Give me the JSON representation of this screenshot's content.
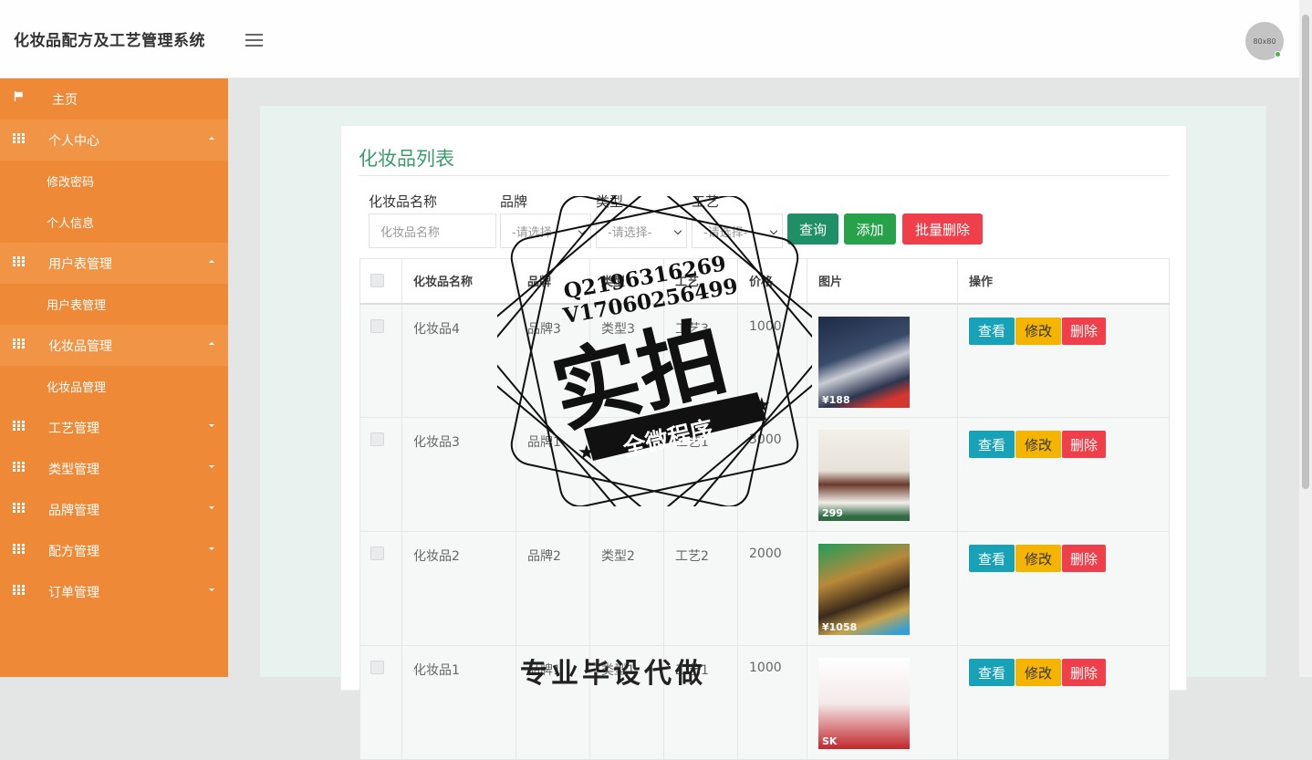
{
  "header": {
    "title": "化妆品配方及工艺管理系统",
    "avatar_text": "80x80"
  },
  "sidebar": {
    "home": "主页",
    "groups": [
      {
        "label": "个人中心",
        "open": true,
        "items": [
          "修改密码",
          "个人信息"
        ]
      },
      {
        "label": "用户表管理",
        "open": true,
        "items": [
          "用户表管理"
        ]
      },
      {
        "label": "化妆品管理",
        "open": true,
        "items": [
          "化妆品管理"
        ]
      },
      {
        "label": "工艺管理",
        "open": false,
        "items": []
      },
      {
        "label": "类型管理",
        "open": false,
        "items": []
      },
      {
        "label": "品牌管理",
        "open": false,
        "items": []
      },
      {
        "label": "配方管理",
        "open": false,
        "items": []
      },
      {
        "label": "订单管理",
        "open": false,
        "items": []
      }
    ]
  },
  "main": {
    "title": "化妆品列表",
    "filters": {
      "name_label": "化妆品名称",
      "name_placeholder": "化妆品名称",
      "brand_label": "品牌",
      "brand_value": "-请选择-",
      "type_label": "类型",
      "type_value": "-请选择-",
      "craft_label": "工艺",
      "craft_value": "-请选择-"
    },
    "buttons": {
      "search": "查询",
      "add": "添加",
      "batch_delete": "批量删除"
    },
    "table": {
      "headers": [
        "化妆品名称",
        "品牌",
        "类型",
        "工艺",
        "价格",
        "图片",
        "操作"
      ],
      "rows": [
        {
          "name": "化妆品4",
          "brand": "品牌3",
          "type": "类型3",
          "craft": "工艺3",
          "price": "1000",
          "img_price": "¥188"
        },
        {
          "name": "化妆品3",
          "brand": "品牌1",
          "type": "类型1",
          "craft": "工艺1",
          "price": "3000",
          "img_price": "299"
        },
        {
          "name": "化妆品2",
          "brand": "品牌2",
          "type": "类型2",
          "craft": "工艺2",
          "price": "2000",
          "img_price": "¥1058"
        },
        {
          "name": "化妆品1",
          "brand": "品牌1",
          "type": "类型1",
          "craft": "工艺1",
          "price": "1000",
          "img_price": "SK"
        }
      ],
      "actions": {
        "view": "查看",
        "edit": "修改",
        "delete": "删除"
      }
    }
  },
  "watermark": {
    "line1": "Q2196316269",
    "line2": "V17060256499",
    "big": "实拍",
    "banner": "全微程序",
    "bottom": "专业毕设代做"
  },
  "colors": {
    "sidebar": "#ee8a37",
    "title_green": "#3b9c6a",
    "search_btn": "#1e8f66",
    "add_btn": "#27a24a",
    "delete_btn": "#ef3f4a",
    "view_btn": "#17a2b8",
    "edit_btn": "#f4b400"
  }
}
